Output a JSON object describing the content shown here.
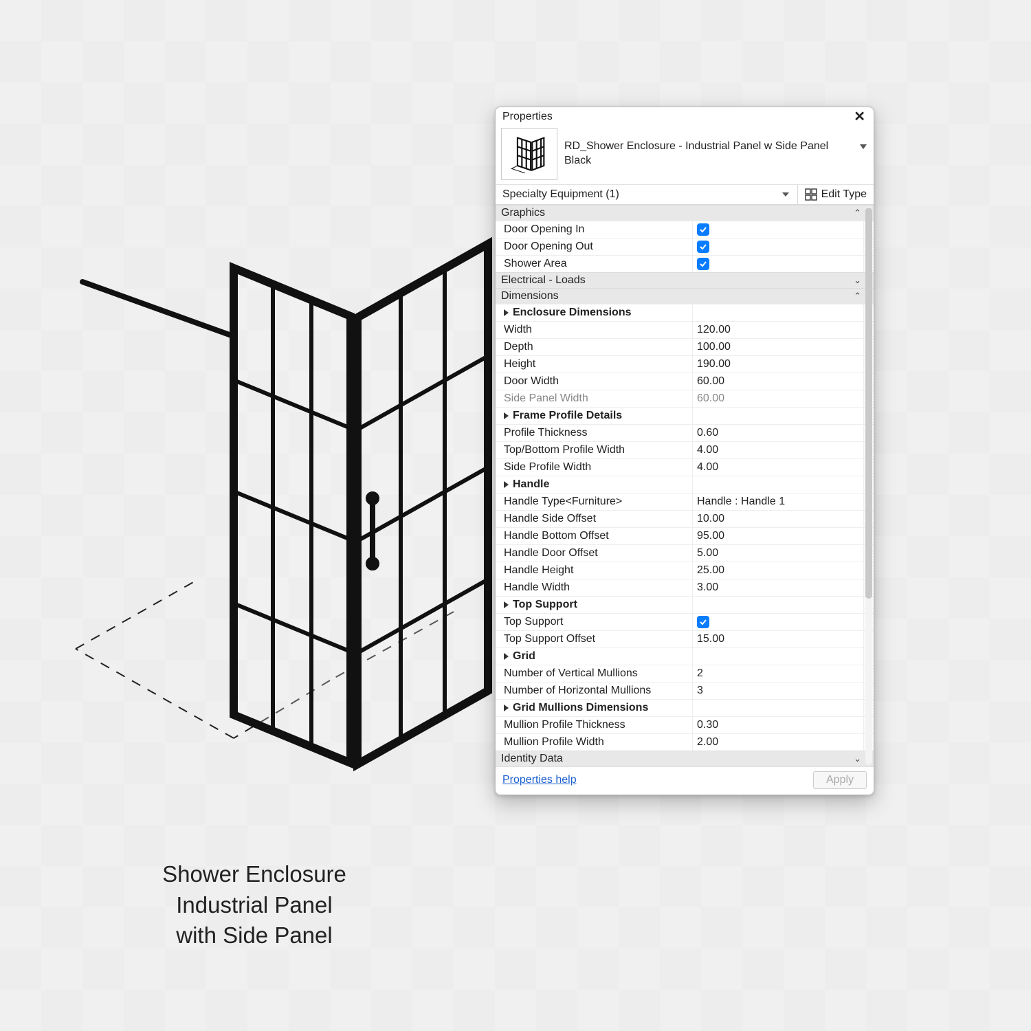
{
  "caption": {
    "line1": "Shower Enclosure",
    "line2": "Industrial Panel",
    "line3": "with Side Panel"
  },
  "panel": {
    "title": "Properties",
    "type_name": "RD_Shower Enclosure - Industrial Panel w Side Panel",
    "type_variant": "Black",
    "filter": "Specialty Equipment (1)",
    "edit_type_label": "Edit Type",
    "footer_link": "Properties help",
    "apply_label": "Apply",
    "sections": {
      "graphics": "Graphics",
      "electrical": "Electrical - Loads",
      "dimensions": "Dimensions",
      "identity": "Identity Data"
    },
    "rows": {
      "door_opening_in": "Door Opening In",
      "door_opening_out": "Door Opening Out",
      "shower_area": "Shower Area",
      "enclosure_dims": "Enclosure Dimensions",
      "width": {
        "label": "Width",
        "value": "120.00"
      },
      "depth": {
        "label": "Depth",
        "value": "100.00"
      },
      "height": {
        "label": "Height",
        "value": "190.00"
      },
      "door_width": {
        "label": "Door Width",
        "value": "60.00"
      },
      "side_panel_width": {
        "label": "Side Panel Width",
        "value": "60.00"
      },
      "frame_profile_details": "Frame Profile Details",
      "profile_thickness": {
        "label": "Profile Thickness",
        "value": "0.60"
      },
      "top_bottom_profile_width": {
        "label": "Top/Bottom Profile Width",
        "value": "4.00"
      },
      "side_profile_width": {
        "label": "Side Profile Width",
        "value": "4.00"
      },
      "handle": "Handle",
      "handle_type": {
        "label": "Handle Type<Furniture>",
        "value": "Handle : Handle 1"
      },
      "handle_side_offset": {
        "label": "Handle Side Offset",
        "value": "10.00"
      },
      "handle_bottom_offset": {
        "label": "Handle Bottom Offset",
        "value": "95.00"
      },
      "handle_door_offset": {
        "label": "Handle Door Offset",
        "value": "5.00"
      },
      "handle_height": {
        "label": "Handle Height",
        "value": "25.00"
      },
      "handle_width": {
        "label": "Handle Width",
        "value": "3.00"
      },
      "top_support_group": "Top Support",
      "top_support": {
        "label": "Top Support"
      },
      "top_support_offset": {
        "label": "Top Support Offset",
        "value": "15.00"
      },
      "grid": "Grid",
      "num_vertical_mullions": {
        "label": "Number of Vertical Mullions",
        "value": "2"
      },
      "num_horizontal_mullions": {
        "label": "Number of Horizontal Mullions",
        "value": "3"
      },
      "grid_mullions_dims": "Grid Mullions Dimensions",
      "mullion_profile_thickness": {
        "label": "Mullion Profile Thickness",
        "value": "0.30"
      },
      "mullion_profile_width": {
        "label": "Mullion Profile Width",
        "value": "2.00"
      }
    }
  }
}
